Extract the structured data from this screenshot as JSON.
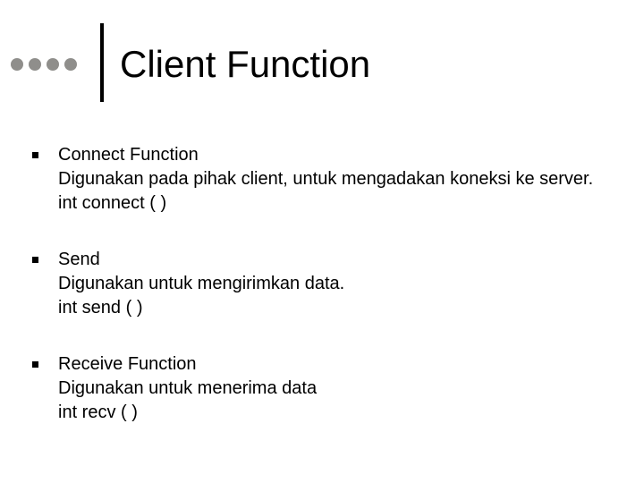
{
  "title": "Client Function",
  "items": [
    {
      "heading": "Connect Function",
      "desc": "Digunakan pada pihak client, untuk mengadakan koneksi ke server.",
      "code": "int connect ( )"
    },
    {
      "heading": "Send",
      "desc": "Digunakan untuk mengirimkan data.",
      "code": "int send ( )"
    },
    {
      "heading": "Receive Function",
      "desc": "Digunakan untuk menerima data",
      "code": "int recv ( )"
    }
  ]
}
